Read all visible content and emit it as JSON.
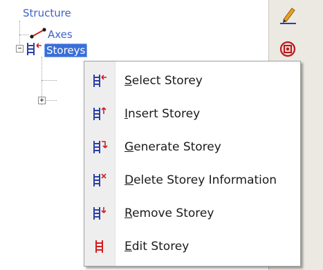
{
  "tree": {
    "root_label": "Structure",
    "axes_label": "Axes",
    "storeys_label": "Storeys",
    "expander_minus": "−",
    "expander_plus": "+"
  },
  "context_menu": {
    "items": [
      {
        "label": "Select Storey",
        "icon": "storey-select-icon"
      },
      {
        "label": "Insert Storey",
        "icon": "storey-insert-icon"
      },
      {
        "label": "Generate Storey",
        "icon": "storey-generate-icon"
      },
      {
        "label": "Delete Storey Information",
        "icon": "storey-delete-icon"
      },
      {
        "label": "Remove Storey",
        "icon": "storey-remove-icon"
      },
      {
        "label": "Edit Storey",
        "icon": "storey-edit-icon"
      }
    ]
  },
  "toolbar": {
    "tools": [
      {
        "icon": "pencil-icon"
      },
      {
        "icon": "zoom-target-icon"
      }
    ]
  },
  "colors": {
    "tree_text": "#3b63c8",
    "selection": "#3a6fd8",
    "storey_icon": "#2a3fa6",
    "accent_red": "#d11c1c",
    "toolbar_bg": "#ece9e2"
  }
}
